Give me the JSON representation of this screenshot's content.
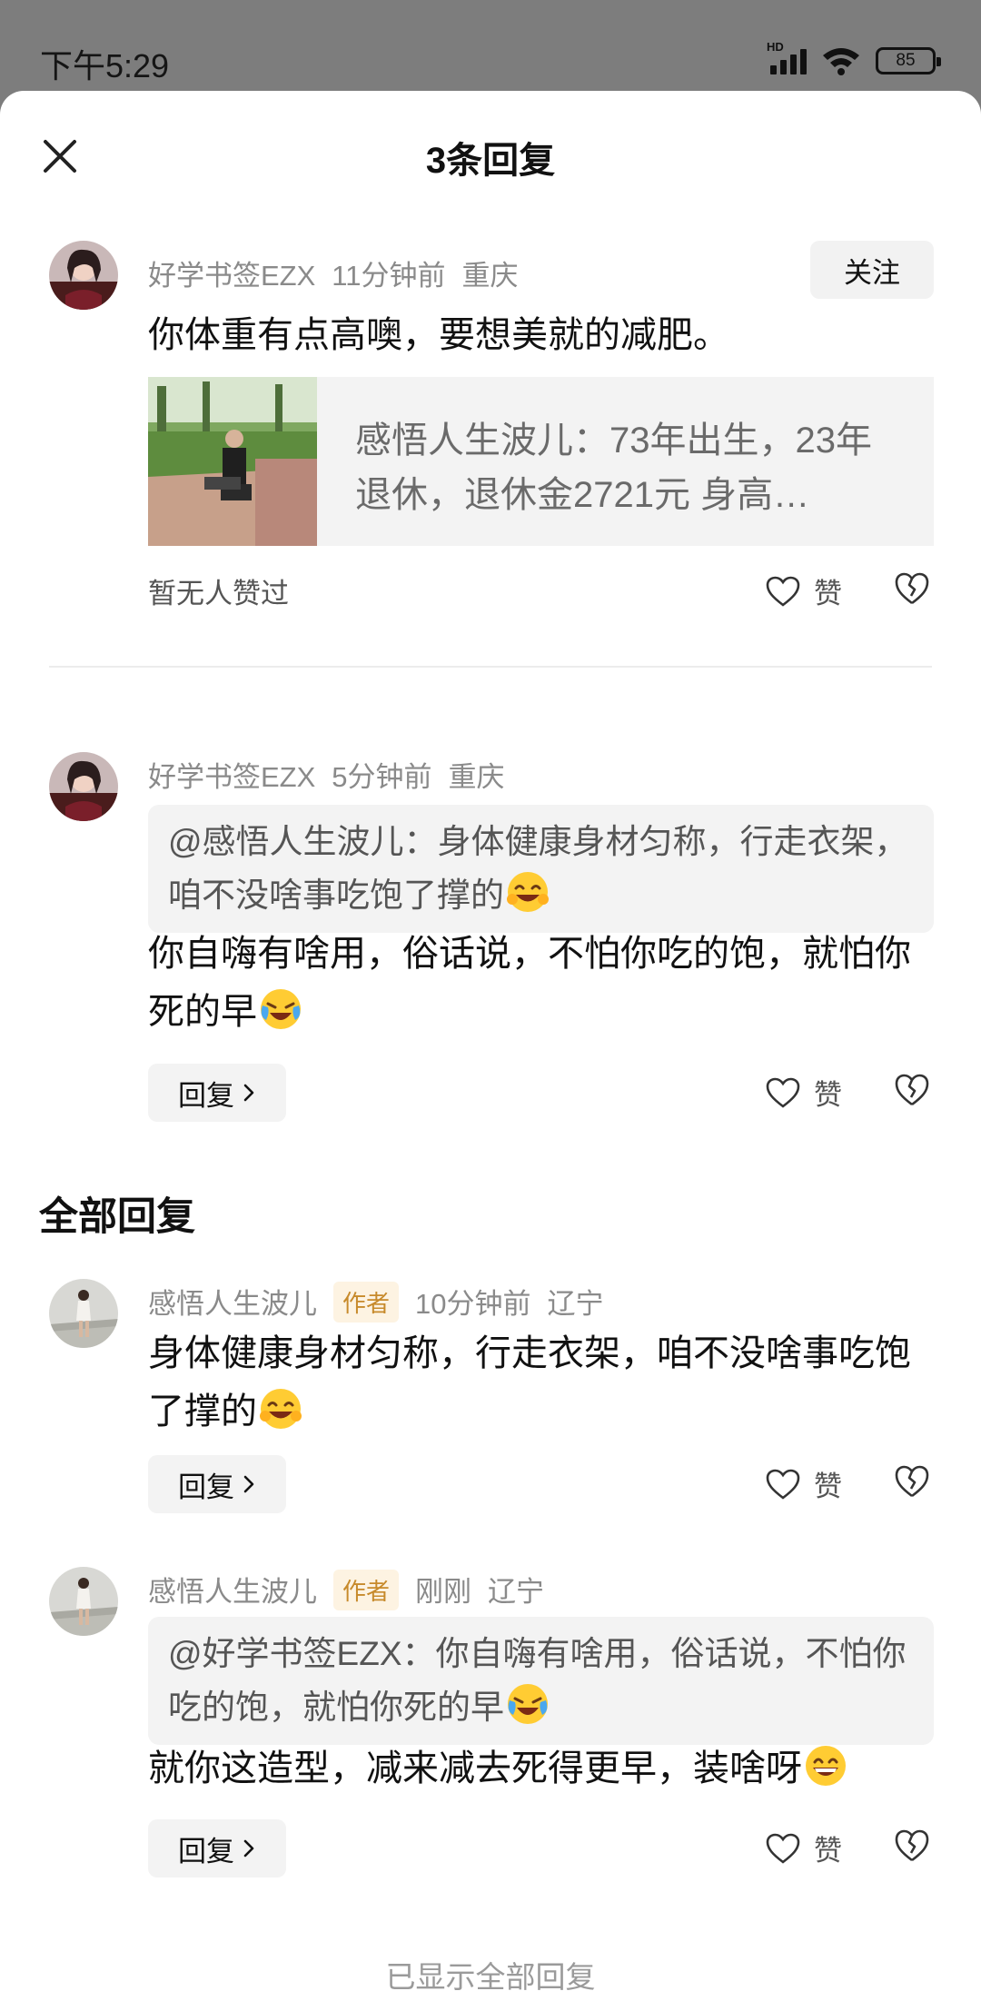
{
  "status_bar": {
    "time": "下午5:29",
    "hd": "HD",
    "battery": "85"
  },
  "header": {
    "title": "3条回复"
  },
  "main_comment": {
    "user": "好学书签EZX",
    "time": "11分钟前",
    "location": "重庆",
    "follow_label": "关注",
    "text": "你体重有点高噢，要想美就的减肥。",
    "share_card_text": "感悟人生波儿：73年出生，23年退休，退休金2721元 身高…",
    "no_likes": "暂无人赞过",
    "like_label": "赞"
  },
  "comment2": {
    "user": "好学书签EZX",
    "time": "5分钟前",
    "location": "重庆",
    "quote": "@感悟人生波儿：身体健康身材匀称，行走衣架，咱不没啥事吃饱了撑的",
    "text": "你自嗨有啥用，俗话说，不怕你吃的饱，就怕你死的早",
    "reply_label": "回复",
    "like_label": "赞"
  },
  "all_replies": {
    "title": "全部回复"
  },
  "reply1": {
    "user": "感悟人生波儿",
    "tag": "作者",
    "time": "10分钟前",
    "location": "辽宁",
    "text": "身体健康身材匀称，行走衣架，咱不没啥事吃饱了撑的",
    "reply_label": "回复",
    "like_label": "赞"
  },
  "reply2": {
    "user": "感悟人生波儿",
    "tag": "作者",
    "time": "刚刚",
    "location": "辽宁",
    "quote": "@好学书签EZX：你自嗨有啥用，俗话说，不怕你吃的饱，就怕你死的早",
    "text": "就你这造型，减来减去死得更早，装啥呀",
    "reply_label": "回复",
    "like_label": "赞"
  },
  "footer": {
    "note": "已显示全部回复"
  },
  "icons": {
    "close": "close-icon",
    "heart": "heart-icon",
    "dislike": "broken-heart-icon",
    "chevron": "chevron-right-icon",
    "emoji_laugh": "grinning-sweat-emoji",
    "emoji_cry": "crying-laughing-emoji",
    "emoji_grin": "big-grin-emoji"
  }
}
